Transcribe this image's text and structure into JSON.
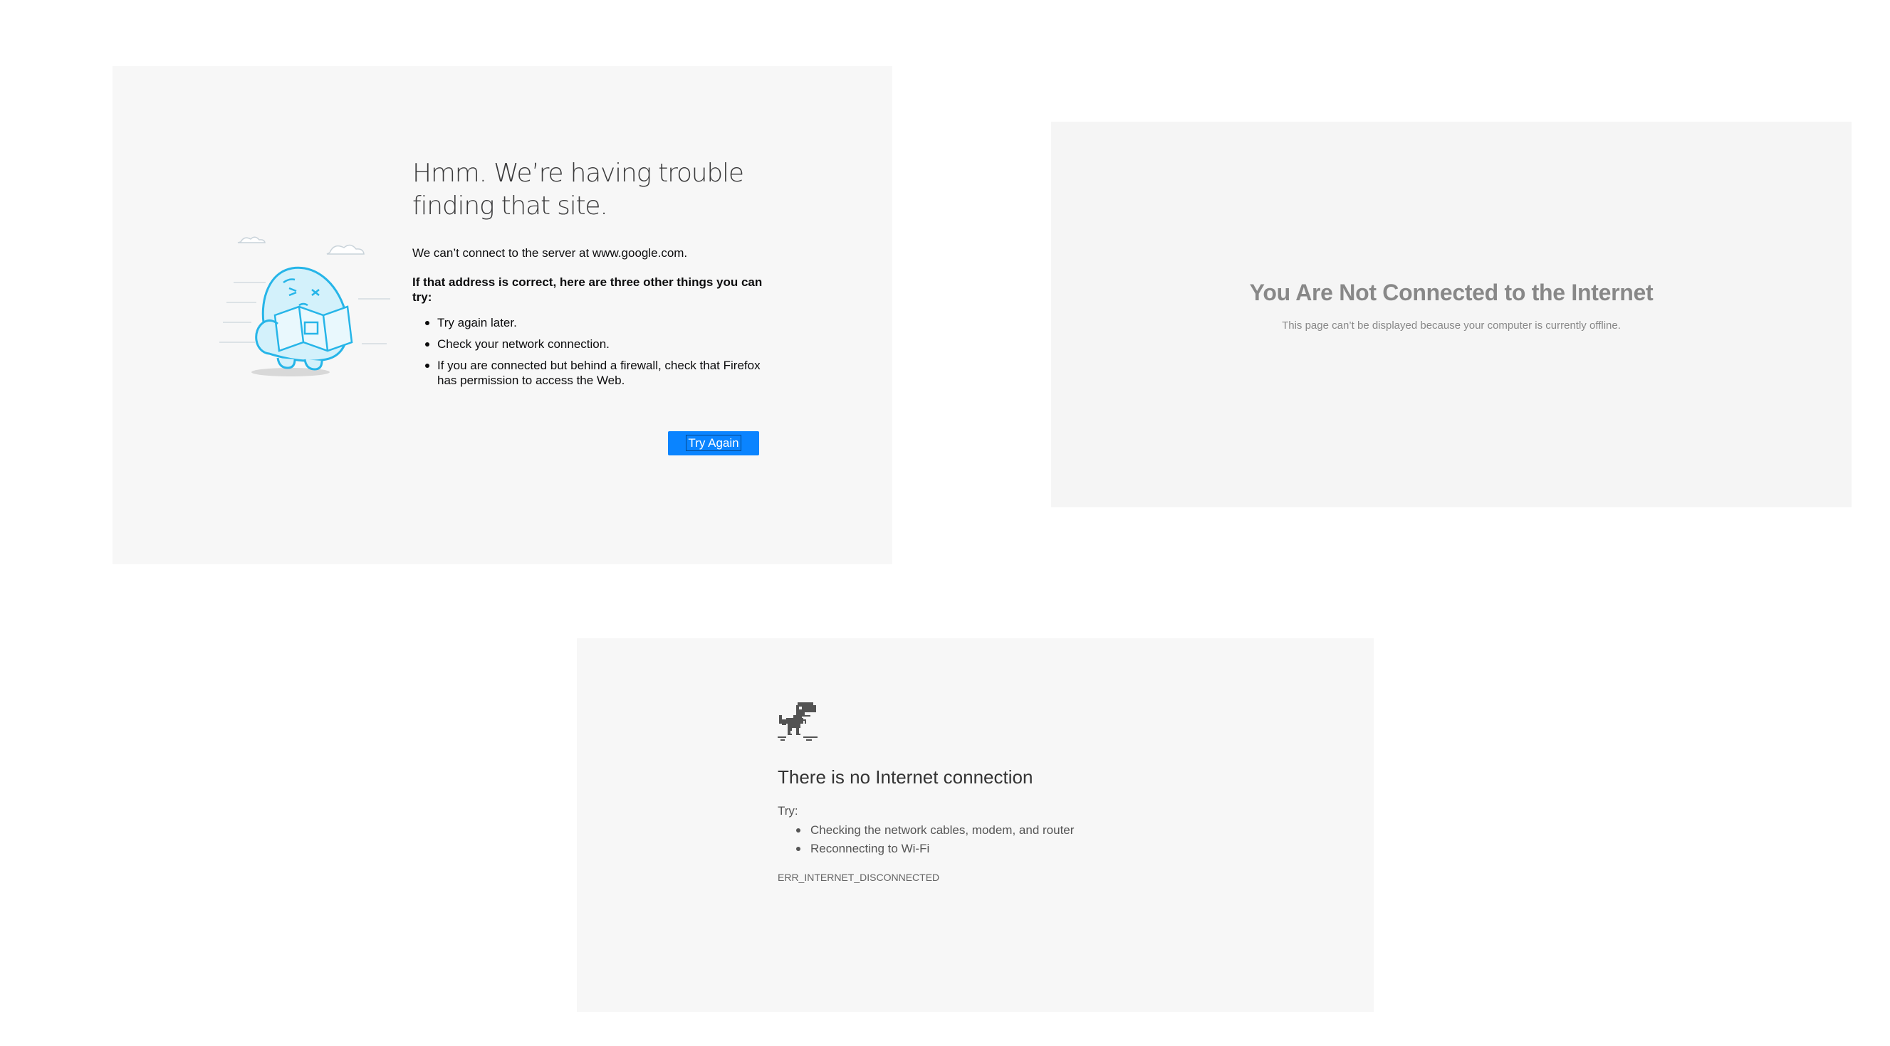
{
  "firefox": {
    "title": "Hmm. We’re having trouble finding that site.",
    "description": "We can’t connect to the server at www.google.com.",
    "suggestions_heading": "If that address is correct, here are three other things you can try:",
    "suggestions": [
      "Try again later.",
      "Check your network connection.",
      "If you are connected but behind a firewall, check that Firefox has permission to access the Web."
    ],
    "try_again_label": "Try Again",
    "accent_color": "#0a84ff",
    "illustration": "blue-monster-holding-map-illustration"
  },
  "safari": {
    "title": "You Are Not Connected to the Internet",
    "description": "This page can’t be displayed because your computer is currently offline."
  },
  "chrome": {
    "icon": "offline-dinosaur-icon",
    "title": "There is no Internet connection",
    "try_label": "Try:",
    "suggestions": [
      "Checking the network cables, modem, and router",
      "Reconnecting to Wi-Fi"
    ],
    "error_code": "ERR_INTERNET_DISCONNECTED"
  }
}
